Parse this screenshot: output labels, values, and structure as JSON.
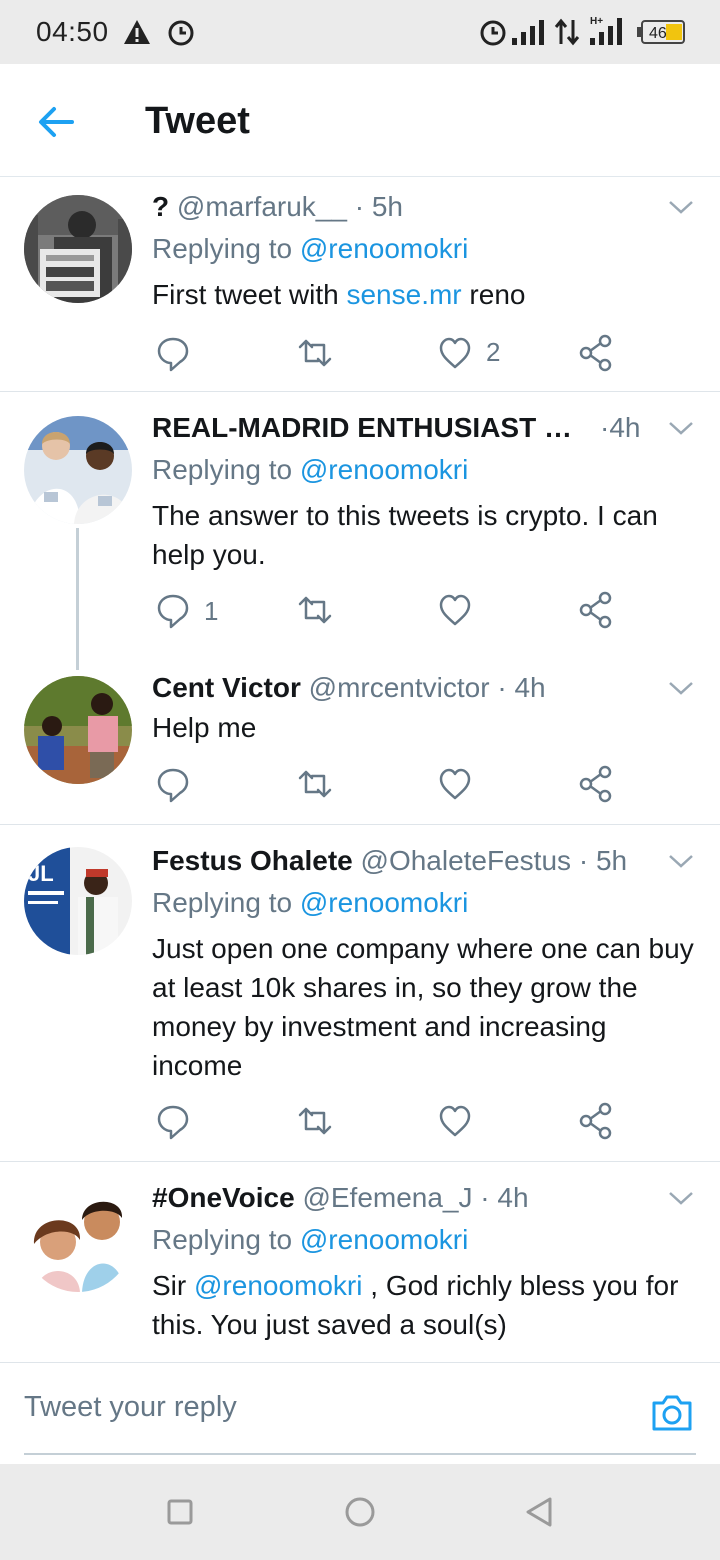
{
  "status_bar": {
    "time": "04:50",
    "battery": "46"
  },
  "header": {
    "title": "Tweet"
  },
  "tweets": [
    {
      "name": "?",
      "handle": "@marfaruk__",
      "time": "5h",
      "replying_prefix": "Replying to",
      "replying_to": "@renoomokri",
      "body_pre": "First tweet with ",
      "body_link": "sense.mr",
      "body_post": " reno",
      "replies": "",
      "retweets": "",
      "likes": "2"
    },
    {
      "name": "REAL-MADRID ENTHUSIAST …",
      "handle": "",
      "time": "4h",
      "replying_prefix": "Replying to",
      "replying_to": "@renoomokri",
      "body_pre": "The answer to this tweets is crypto. I can help you.",
      "replies": "1",
      "retweets": "",
      "likes": ""
    },
    {
      "name": "Cent Victor",
      "handle": "@mrcentvictor",
      "time": "4h",
      "body_pre": "Help me",
      "replies": "",
      "retweets": "",
      "likes": ""
    },
    {
      "name": "Festus Ohalete",
      "handle": "@OhaleteFestus",
      "time": "5h",
      "replying_prefix": "Replying to",
      "replying_to": "@renoomokri",
      "body_pre": "Just open one company where one can buy at least 10k shares in, so they grow the money by investment and increasing income",
      "replies": "",
      "retweets": "",
      "likes": ""
    },
    {
      "name": "#OneVoice",
      "handle": "@Efemena_J",
      "time": "4h",
      "replying_prefix": "Replying to",
      "replying_to": "@renoomokri",
      "body_pre": "Sir ",
      "body_link": "@renoomokri",
      "body_post": " , God richly bless you for this. You just saved a soul(s)"
    }
  ],
  "composer": {
    "placeholder": "Tweet your reply"
  },
  "icons": {
    "back": "arrow-left-icon",
    "more": "chevron-down-icon",
    "reply": "reply-icon",
    "retweet": "retweet-icon",
    "like": "heart-icon",
    "share": "share-icon",
    "camera": "camera-icon",
    "nav_recents": "square-icon",
    "nav_home": "circle-icon",
    "nav_back": "triangle-back-icon"
  },
  "colors": {
    "accent": "#1da1f2",
    "link": "#1b95e0",
    "secondary_text": "#657786",
    "separator": "#e1e8ed"
  }
}
